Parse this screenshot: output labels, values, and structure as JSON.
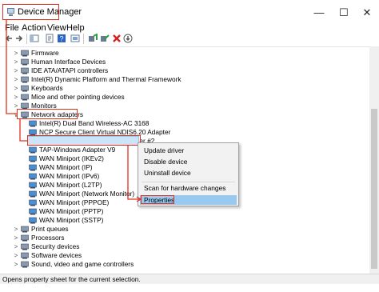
{
  "window": {
    "title": "Device Manager",
    "minimize_glyph": "—",
    "maximize_glyph": "☐",
    "close_glyph": "✕"
  },
  "menu": [
    "File",
    "Action",
    "View",
    "Help"
  ],
  "toolbar": {
    "icons": [
      "back-arrow-icon",
      "forward-arrow-icon",
      "show-hide-console-tree-icon",
      "properties-icon",
      "help-icon",
      "resource-view-icon",
      "update-driver-icon",
      "disable-device-icon",
      "uninstall-device-icon",
      "scan-hardware-icon"
    ]
  },
  "tree": {
    "items": [
      {
        "label": "Firmware",
        "expander": ">",
        "icon": "firmware-icon"
      },
      {
        "label": "Human Interface Devices",
        "expander": ">",
        "icon": "hid-icon"
      },
      {
        "label": "IDE ATA/ATAPI controllers",
        "expander": ">",
        "icon": "ide-icon"
      },
      {
        "label": "Intel(R) Dynamic Platform and Thermal Framework",
        "expander": ">",
        "icon": "thermal-icon"
      },
      {
        "label": "Keyboards",
        "expander": ">",
        "icon": "keyboard-icon"
      },
      {
        "label": "Mice and other pointing devices",
        "expander": ">",
        "icon": "mouse-icon"
      },
      {
        "label": "Monitors",
        "expander": ">",
        "icon": "monitor-icon"
      },
      {
        "label": "Network adapters",
        "expander": "v",
        "icon": "network-adapter-icon"
      },
      {
        "label": "Intel(R) Dual Band Wireless-AC 3168",
        "child": true,
        "icon": "network-card-icon"
      },
      {
        "label": "NCP Secure Client Virtual NDIS6.20 Adapter",
        "child": true,
        "icon": "network-card-icon"
      },
      {
        "label": "Realtek PCIe GbE Family Controller #2",
        "child": true,
        "icon": "network-card-icon",
        "selected": true
      },
      {
        "label": "TAP-Windows Adapter V9",
        "child": true,
        "icon": "network-card-icon"
      },
      {
        "label": "WAN Miniport (IKEv2)",
        "child": true,
        "icon": "network-card-icon"
      },
      {
        "label": "WAN Miniport (IP)",
        "child": true,
        "icon": "network-card-icon"
      },
      {
        "label": "WAN Miniport (IPv6)",
        "child": true,
        "icon": "network-card-icon"
      },
      {
        "label": "WAN Miniport (L2TP)",
        "child": true,
        "icon": "network-card-icon"
      },
      {
        "label": "WAN Miniport (Network Monitor)",
        "child": true,
        "icon": "network-card-icon"
      },
      {
        "label": "WAN Miniport (PPPOE)",
        "child": true,
        "icon": "network-card-icon"
      },
      {
        "label": "WAN Miniport (PPTP)",
        "child": true,
        "icon": "network-card-icon"
      },
      {
        "label": "WAN Miniport (SSTP)",
        "child": true,
        "icon": "network-card-icon"
      },
      {
        "label": "Print queues",
        "expander": ">",
        "icon": "printer-icon"
      },
      {
        "label": "Processors",
        "expander": ">",
        "icon": "processor-icon"
      },
      {
        "label": "Security devices",
        "expander": ">",
        "icon": "security-device-icon"
      },
      {
        "label": "Software devices",
        "expander": ">",
        "icon": "software-device-icon"
      },
      {
        "label": "Sound, video and game controllers",
        "expander": ">",
        "icon": "sound-icon"
      }
    ]
  },
  "context_menu": {
    "update_driver": "Update driver",
    "disable_device": "Disable device",
    "uninstall_device": "Uninstall device",
    "scan": "Scan for hardware changes",
    "properties": "Properties"
  },
  "status": "Opens property sheet for the current selection.",
  "colors": {
    "annotation_red": "#e0301e",
    "selection_blue": "#cce4f7",
    "menu_highlight": "#99c9ef"
  }
}
